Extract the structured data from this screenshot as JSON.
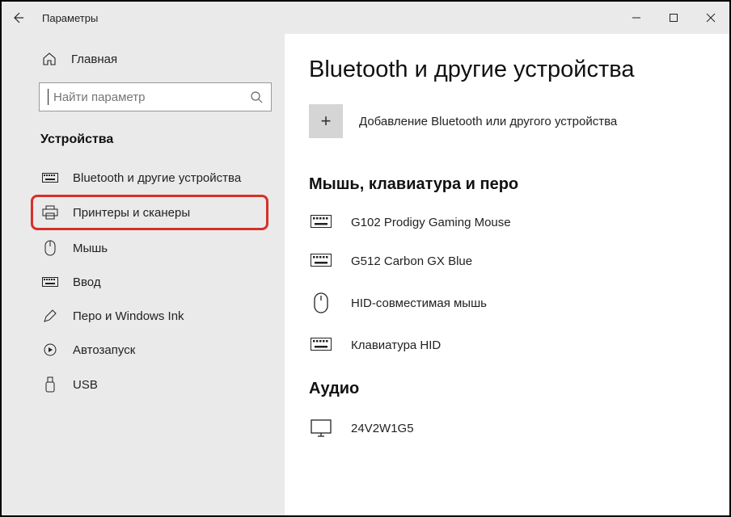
{
  "window": {
    "title": "Параметры"
  },
  "sidebar": {
    "home": "Главная",
    "search_placeholder": "Найти параметр",
    "category": "Устройства",
    "items": [
      {
        "label": "Bluetooth и другие устройства"
      },
      {
        "label": "Принтеры и сканеры"
      },
      {
        "label": "Мышь"
      },
      {
        "label": "Ввод"
      },
      {
        "label": "Перо и Windows Ink"
      },
      {
        "label": "Автозапуск"
      },
      {
        "label": "USB"
      }
    ]
  },
  "main": {
    "heading": "Bluetooth и другие устройства",
    "add_label": "Добавление Bluetooth или другого устройства",
    "section1": {
      "title": "Мышь, клавиатура и перо",
      "devices": [
        {
          "label": "G102 Prodigy Gaming Mouse"
        },
        {
          "label": "G512 Carbon GX Blue"
        },
        {
          "label": "HID-совместимая мышь"
        },
        {
          "label": "Клавиатура HID"
        }
      ]
    },
    "section2": {
      "title": "Аудио",
      "devices": [
        {
          "label": "24V2W1G5"
        }
      ]
    }
  }
}
